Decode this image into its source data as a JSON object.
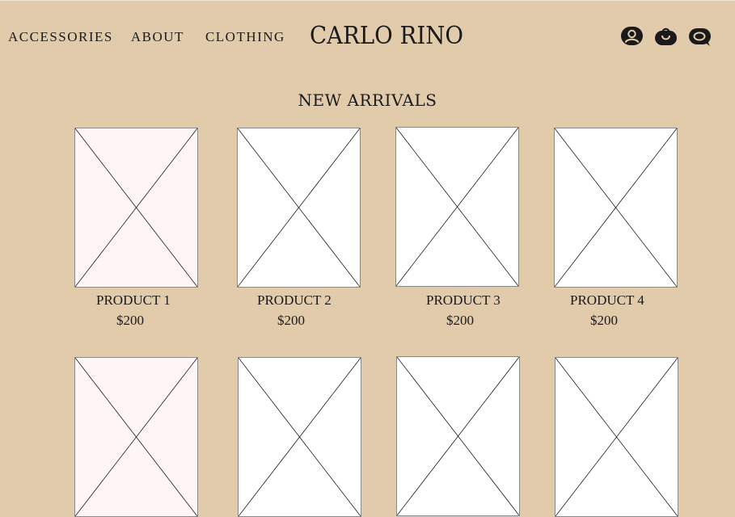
{
  "nav": {
    "items": [
      {
        "label": "ACCESSORIES"
      },
      {
        "label": "ABOUT"
      },
      {
        "label": "CLOTHING"
      }
    ]
  },
  "brand": {
    "logo": "CARLO RINO"
  },
  "header_icons": [
    "account-icon",
    "shopping-bag-icon",
    "chat-icon"
  ],
  "section": {
    "title": "NEW ARRIVALS"
  },
  "products": [
    {
      "name": "PRODUCT 1",
      "price": "$200",
      "image_fill": "#fdf6f5"
    },
    {
      "name": "PRODUCT 2",
      "price": "$200",
      "image_fill": "#ffffff"
    },
    {
      "name": "PRODUCT 3",
      "price": "$200",
      "image_fill": "#ffffff"
    },
    {
      "name": "PRODUCT 4",
      "price": "$200",
      "image_fill": "#ffffff"
    }
  ],
  "products_row2": [
    {
      "image_fill": "#fdf6f5"
    },
    {
      "image_fill": "#ffffff"
    },
    {
      "image_fill": "#ffffff"
    },
    {
      "image_fill": "#ffffff"
    }
  ],
  "colors": {
    "background": "#e2cbab",
    "text": "#1a1a1a"
  }
}
